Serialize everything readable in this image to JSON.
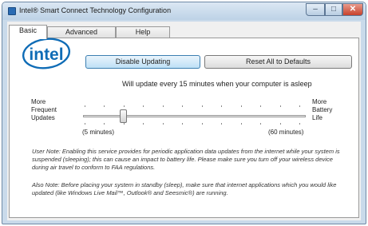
{
  "window": {
    "title": "Intel® Smart Connect Technology Configuration",
    "controls": {
      "minimize": "–",
      "maximize": "□",
      "close": "✕"
    }
  },
  "tabs": [
    {
      "label": "Basic",
      "active": true
    },
    {
      "label": "Advanced",
      "active": false
    },
    {
      "label": "Help",
      "active": false
    }
  ],
  "logo": {
    "text": "intel"
  },
  "buttons": {
    "disable": "Disable Updating",
    "reset": "Reset All to Defaults"
  },
  "status": "Will update every 15 minutes when your computer is asleep",
  "slider": {
    "left_label_1": "More",
    "left_label_2": "Frequent",
    "left_label_3": "Updates",
    "right_label_1": "More",
    "right_label_2": "Battery",
    "right_label_3": "Life",
    "min_label": "(5 minutes)",
    "max_label": "(60 minutes)",
    "value_minutes": 15
  },
  "notes": {
    "user": "User Note: Enabling this service provides for periodic application data updates from the internet while your system is suspended (sleeping); this can cause an impact to battery life. Please make sure you turn off your wireless device during air travel to conform to FAA regulations.",
    "also": "Also Note: Before placing your system in standby (sleep), make sure that internet applications which you would like updated (like Windows Live Mail™, Outlook® and Seesmic®) are running."
  },
  "colors": {
    "intel_blue": "#0f6cb6",
    "title_bg": "#c9daea",
    "close": "#c7402b"
  }
}
